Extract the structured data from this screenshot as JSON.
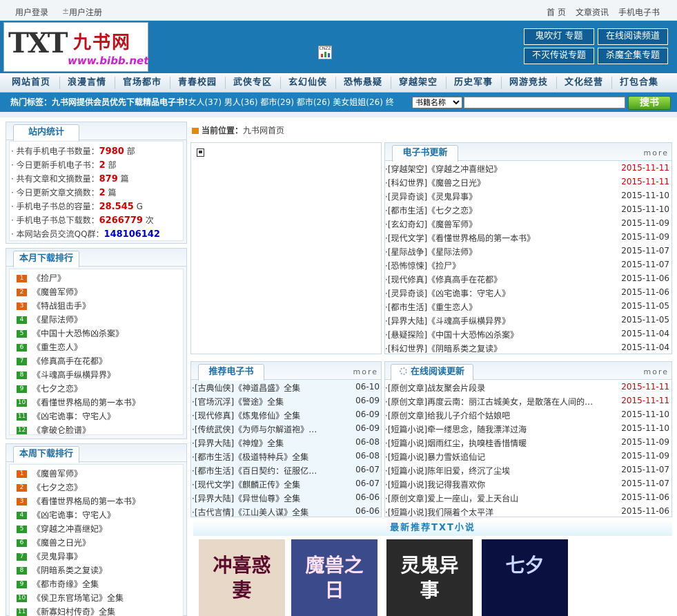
{
  "topbar": {
    "login": "用户登录",
    "register_icon": "±",
    "register": "用户注册",
    "links": [
      "首 页",
      "文章资讯",
      "手机电子书"
    ]
  },
  "logo": {
    "txt": "TXT",
    "cn": "九书网",
    "url": "www.bibb.net"
  },
  "cnzz": "CNZZ",
  "header_buttons": [
    "鬼吹灯 专题",
    "在线阅读频道",
    "不灭传说专题",
    "杀魔全集专题"
  ],
  "nav": [
    "网站首页",
    "浪漫言情",
    "官场都市",
    "青春校园",
    "武侠专区",
    "玄幻仙侠",
    "恐怖悬疑",
    "穿越架空",
    "历史军事",
    "网游竞技",
    "文化经营",
    "打包合集"
  ],
  "tagbar": {
    "label": "热门标签：九书网提供会员优先下载精品电子书!",
    "tags": "女人(37) 男人(36) 都市(29) 都市(26) 美女姐姐(26) 终",
    "select": "书籍名称",
    "search_btn": "搜书"
  },
  "location": {
    "label": "当前位置：",
    "value": "九书网首页"
  },
  "stats": {
    "title": "站内统计",
    "items": [
      {
        "label": "· 共有手机电子书数量：",
        "value": "7980",
        "unit": " 部"
      },
      {
        "label": "· 今日更新手机电子书：",
        "value": "2",
        "unit": " 部"
      },
      {
        "label": "· 共有文章和文摘数量：",
        "value": "879",
        "unit": " 篇"
      },
      {
        "label": "· 今日更新文章文摘数：",
        "value": "2",
        "unit": " 篇"
      },
      {
        "label": "· 手机电子书总的容量：",
        "value": "28.545",
        "unit": " G"
      },
      {
        "label": "· 手机电子书总下载数：",
        "value": "6266779",
        "unit": " 次"
      },
      {
        "label": "· 本网站会员交流QQ群：",
        "value": "148106142",
        "unit": ""
      }
    ]
  },
  "month_rank": {
    "title": "本月下载排行",
    "items": [
      "《捡尸》",
      "《魔兽军师》",
      "《特战狙击手》",
      "《星际法师》",
      "《中国十大恐怖凶杀案》",
      "《重生恋人》",
      "《修真高手在花都》",
      "《斗魂高手纵横异界》",
      "《七夕之恋》",
      "《看懂世界格局的第一本书》",
      "《凶宅诡事：守宅人》",
      "《拿破仑脸谱》"
    ]
  },
  "week_rank": {
    "title": "本周下载排行",
    "items": [
      "《魔兽军师》",
      "《七夕之恋》",
      "《看懂世界格局的第一本书》",
      "《凶宅诡事：守宅人》",
      "《穿越之冲喜继妃》",
      "《魔兽之日光》",
      "《灵鬼异事》",
      "《阴暗系类之复读》",
      "《都市奇缘》全集",
      "《侯卫东官场笔记》全集",
      "《新寡妇村传奇》全集"
    ]
  },
  "rank_colors": [
    "#e06010",
    "#e06010",
    "#e06010",
    "#2a9a2a",
    "#2a9a2a",
    "#2a9a2a",
    "#2a9a2a",
    "#2a9a2a",
    "#2a9a2a",
    "#2a9a2a",
    "#2a9a2a",
    "#2a9a2a"
  ],
  "ebook_update": {
    "title": "电子书更新",
    "more": "more",
    "rows": [
      {
        "t": "·[穿越架空]《穿越之冲喜继妃》",
        "d": "2015-11-11",
        "hot": true
      },
      {
        "t": "·[科幻世界]《魔兽之日光》",
        "d": "2015-11-11",
        "hot": true
      },
      {
        "t": "·[灵异奇谈]《灵鬼异事》",
        "d": "2015-11-10",
        "hot": false
      },
      {
        "t": "·[都市生活]《七夕之恋》",
        "d": "2015-11-10",
        "hot": false
      },
      {
        "t": "·[玄幻奇幻]《魔兽军师》",
        "d": "2015-11-09",
        "hot": false
      },
      {
        "t": "·[现代文学]《看懂世界格局的第一本书》",
        "d": "2015-11-09",
        "hot": false
      },
      {
        "t": "·[星际战争]《星际法师》",
        "d": "2015-11-07",
        "hot": false
      },
      {
        "t": "·[恐怖惊悚]《捡尸》",
        "d": "2015-11-07",
        "hot": false
      },
      {
        "t": "·[现代修真]《修真高手在花都》",
        "d": "2015-11-06",
        "hot": false
      },
      {
        "t": "·[灵异奇谈]《凶宅诡事：守宅人》",
        "d": "2015-11-06",
        "hot": false
      },
      {
        "t": "·[都市生活]《重生恋人》",
        "d": "2015-11-05",
        "hot": false
      },
      {
        "t": "·[异界大陆]《斗魂高手纵横异界》",
        "d": "2015-11-05",
        "hot": false
      },
      {
        "t": "·[悬疑探险]《中国十大恐怖凶杀案》",
        "d": "2015-11-04",
        "hot": false
      },
      {
        "t": "·[科幻世界]《阴暗系类之复读》",
        "d": "2015-11-04",
        "hot": false
      }
    ]
  },
  "recommend": {
    "title": "推荐电子书",
    "more": "more",
    "rows": [
      {
        "t": "·[古典仙侠]《神道昌盛》全集",
        "d": "06-10"
      },
      {
        "t": "·[官场沉浮]《警途》全集",
        "d": "06-09"
      },
      {
        "t": "·[现代修真]《炼鬼修仙》全集",
        "d": "06-09"
      },
      {
        "t": "·[传统武侠]《为师与尔解道袍》全…",
        "d": "06-09"
      },
      {
        "t": "·[异界大陆]《神煌》全集",
        "d": "06-08"
      },
      {
        "t": "·[都市生活]《极道特种兵》全集",
        "d": "06-08"
      },
      {
        "t": "·[都市生活]《百日契约：征服亿万…",
        "d": "06-07"
      },
      {
        "t": "·[现代文学]《麒麟正传》全集",
        "d": "06-07"
      },
      {
        "t": "·[异界大陆]《异世仙尊》全集",
        "d": "06-06"
      },
      {
        "t": "·[古代言情]《江山美人谋》全集",
        "d": "06-06"
      }
    ]
  },
  "online": {
    "title": "在线阅读更新",
    "more": "more",
    "rows": [
      {
        "t": "·[原创文章]战友聚会片段录",
        "d": "2015-11-11",
        "hot": true
      },
      {
        "t": "·[原创文章]再度云南：丽江古城美女，是散落在人间的…",
        "d": "2015-11-11",
        "hot": true
      },
      {
        "t": "·[原创文章]给我儿子介绍个姑娘吧",
        "d": "2015-11-10",
        "hot": false
      },
      {
        "t": "·[短篇小说]牵一缕思念，随我漂洋过海",
        "d": "2015-11-10",
        "hot": false
      },
      {
        "t": "·[短篇小说]烟雨红尘，执嗅桂香惜情暖",
        "d": "2015-11-09",
        "hot": false
      },
      {
        "t": "·[短篇小说]暴力雪妖追仙记",
        "d": "2015-11-09",
        "hot": false
      },
      {
        "t": "·[短篇小说]陈年旧爱，终沉了尘埃",
        "d": "2015-11-07",
        "hot": false
      },
      {
        "t": "·[短篇小说]我记得我喜欢你",
        "d": "2015-11-07",
        "hot": false
      },
      {
        "t": "·[原创文章]爱上一座山，爱上天台山",
        "d": "2015-11-06",
        "hot": false
      },
      {
        "t": "·[短篇小说]我们隔着个太平洋",
        "d": "2015-11-06",
        "hot": false
      }
    ]
  },
  "latest": {
    "title": "最新推荐TXT小说",
    "covers": [
      {
        "text": "冲喜惑妻",
        "bg": "#e8d8c8",
        "fg": "#5a0a2a"
      },
      {
        "text": "魔兽之日",
        "bg": "#3a4a8a",
        "fg": "#ffe0f0"
      },
      {
        "text": "灵鬼异事",
        "bg": "#2a2a2a",
        "fg": "#ffffff"
      },
      {
        "text": "七夕",
        "bg": "#0a1040",
        "fg": "#c8d8ff"
      }
    ]
  },
  "colors": {
    "accent": "#1b78b3",
    "hot_date": "#d40000",
    "stat_value": "#d40000",
    "qq": "#0000cc"
  }
}
